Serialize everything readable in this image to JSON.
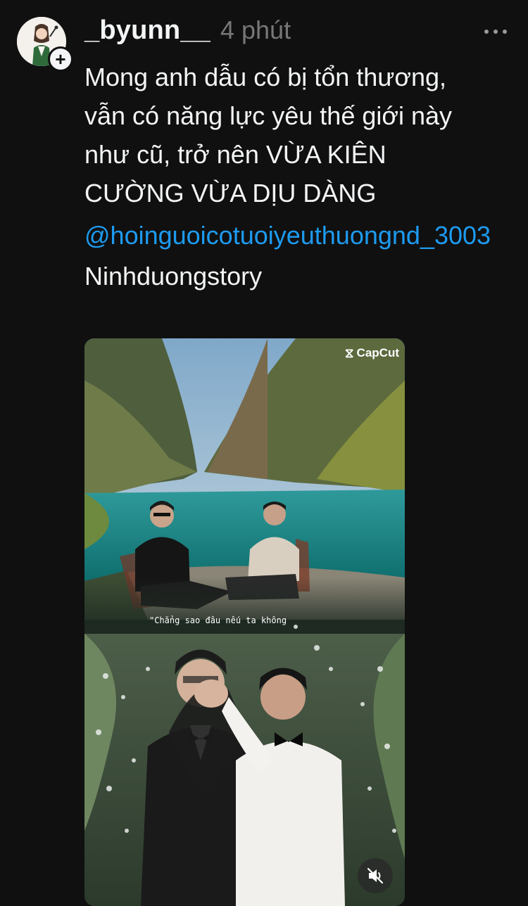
{
  "post": {
    "author": {
      "username": "_byunn__",
      "avatar_icon": "avatar-illustration",
      "follow_icon": "plus-icon"
    },
    "timestamp": "4 phút",
    "more_icon": "more-horizontal-icon",
    "text_lines": [
      "Mong anh dẫu có bị tổn thương,",
      "vẫn có năng lực yêu thế giới này",
      "như cũ, trở nên VỪA KIÊN",
      "CƯỜNG VỪA DỊU DÀNG"
    ],
    "mention": "@hoinguoicotuoiyeuthuongnd_3003",
    "hashtag": "Ninhduongstory",
    "media": {
      "type": "video",
      "watermark": "CapCut",
      "caption": "\"Chẳng sao đâu nếu ta không",
      "mute_icon": "speaker-muted-icon"
    }
  },
  "colors": {
    "background": "#101010",
    "text": "#f3f5f7",
    "secondary": "#777777",
    "link": "#1d9bf0"
  }
}
